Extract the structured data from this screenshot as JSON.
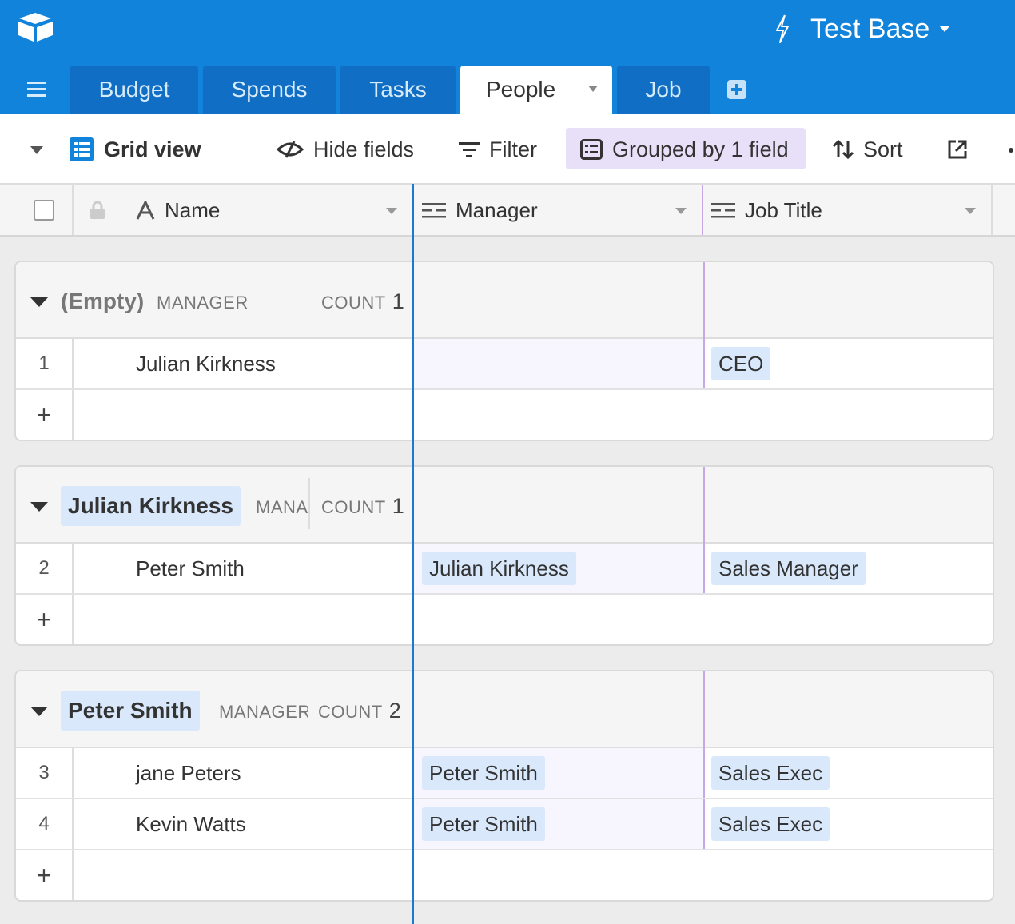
{
  "app": {
    "base_name": "Test Base",
    "tabs": [
      {
        "label": "Budget"
      },
      {
        "label": "Spends"
      },
      {
        "label": "Tasks"
      },
      {
        "label": "People"
      },
      {
        "label": "Job"
      }
    ],
    "active_tab": "People"
  },
  "toolbar": {
    "view_name": "Grid view",
    "hide_fields": "Hide fields",
    "filter": "Filter",
    "grouped": "Grouped by 1 field",
    "sort": "Sort"
  },
  "columns": {
    "name": "Name",
    "manager": "Manager",
    "job_title": "Job Title"
  },
  "groups": [
    {
      "title": "(Empty)",
      "field": "MANAGER",
      "count_label": "COUNT",
      "count": "1",
      "rows": [
        {
          "num": "1",
          "name": "Julian Kirkness",
          "manager": "",
          "job": "CEO"
        }
      ]
    },
    {
      "title": "Julian Kirkness",
      "field": "MANAGER",
      "count_label": "COUNT",
      "count": "1",
      "rows": [
        {
          "num": "2",
          "name": "Peter Smith",
          "manager": "Julian Kirkness",
          "job": "Sales Manager"
        }
      ]
    },
    {
      "title": "Peter Smith",
      "field": "MANAGER",
      "count_label": "COUNT",
      "count": "2",
      "rows": [
        {
          "num": "3",
          "name": "jane Peters",
          "manager": "Peter Smith",
          "job": "Sales Exec"
        },
        {
          "num": "4",
          "name": "Kevin Watts",
          "manager": "Peter Smith",
          "job": "Sales Exec"
        }
      ]
    }
  ],
  "add_row_symbol": "+",
  "colors": {
    "header_blue": "#1283da",
    "tab_blue": "#106ec4",
    "chip_blue": "#d9e9fb",
    "grouped_purple": "#e8e0f8",
    "column_purple": "#c6a8e6"
  },
  "icons": {
    "logo": "airtable-logo-icon",
    "bolt": "bolt-icon",
    "menu": "hamburger-menu-icon",
    "add_tab": "plus-square-icon",
    "grid": "grid-view-icon",
    "hide": "eye-slash-icon",
    "filter": "filter-icon",
    "group": "group-list-icon",
    "sort": "sort-arrows-icon",
    "share": "share-external-icon",
    "lock": "lock-icon",
    "text_field": "text-field-icon",
    "link_field": "linked-record-icon"
  }
}
